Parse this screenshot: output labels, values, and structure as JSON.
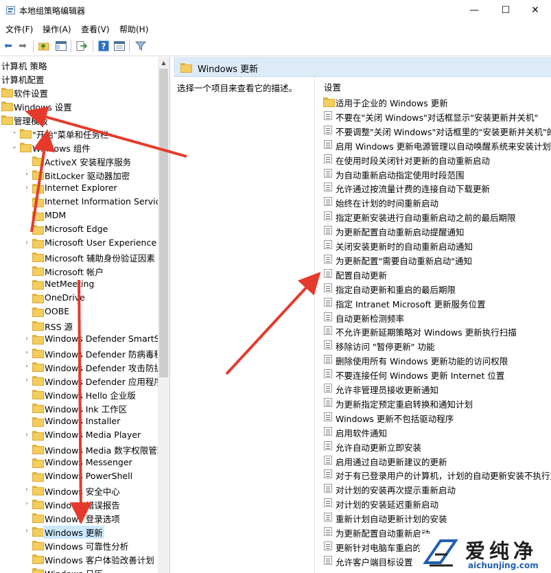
{
  "window": {
    "title": "本地组策略编辑器",
    "min_glyph": "—",
    "max_glyph": "☐",
    "close_glyph": "✕"
  },
  "menu": [
    "文件(F)",
    "操作(A)",
    "查看(V)",
    "帮助(H)"
  ],
  "tree": {
    "items": [
      {
        "label": "计算机 策略",
        "level": 0,
        "expander": ""
      },
      {
        "label": "计算机配置",
        "level": 0,
        "expander": ""
      },
      {
        "label": "软件设置",
        "level": 0,
        "expander": "",
        "folder": true
      },
      {
        "label": "Windows 设置",
        "level": 0,
        "expander": "",
        "folder": true
      },
      {
        "label": "管理模板",
        "level": 0,
        "expander": "",
        "folder": true
      },
      {
        "label": "\"开始\"菜单和任务栏",
        "level": 1,
        "expander": "›"
      },
      {
        "label": "Windows 组件",
        "level": 1,
        "expander": "⌄"
      },
      {
        "label": "ActiveX 安装程序服务",
        "level": 2,
        "expander": ""
      },
      {
        "label": "BitLocker 驱动器加密",
        "level": 2,
        "expander": "›"
      },
      {
        "label": "Internet Explorer",
        "level": 2,
        "expander": "›"
      },
      {
        "label": "Internet Information Services",
        "level": 2,
        "expander": ""
      },
      {
        "label": "MDM",
        "level": 2,
        "expander": ""
      },
      {
        "label": "Microsoft Edge",
        "level": 2,
        "expander": ""
      },
      {
        "label": "Microsoft User Experience Virt",
        "level": 2,
        "expander": "›"
      },
      {
        "label": "Microsoft 辅助身份验证因素",
        "level": 2,
        "expander": ""
      },
      {
        "label": "Microsoft 帐户",
        "level": 2,
        "expander": ""
      },
      {
        "label": "NetMeeting",
        "level": 2,
        "expander": ""
      },
      {
        "label": "OneDrive",
        "level": 2,
        "expander": ""
      },
      {
        "label": "OOBE",
        "level": 2,
        "expander": ""
      },
      {
        "label": "RSS 源",
        "level": 2,
        "expander": ""
      },
      {
        "label": "Windows Defender SmartScre",
        "level": 2,
        "expander": "›"
      },
      {
        "label": "Windows Defender 防病毒程序",
        "level": 2,
        "expander": "›"
      },
      {
        "label": "Windows Defender 攻击防护",
        "level": 2,
        "expander": "›"
      },
      {
        "label": "Windows Defender 应用程序防",
        "level": 2,
        "expander": "›"
      },
      {
        "label": "Windows Hello 企业版",
        "level": 2,
        "expander": ""
      },
      {
        "label": "Windows Ink 工作区",
        "level": 2,
        "expander": ""
      },
      {
        "label": "Windows Installer",
        "level": 2,
        "expander": ""
      },
      {
        "label": "Windows Media Player",
        "level": 2,
        "expander": "›"
      },
      {
        "label": "Windows Media 数字权限管理",
        "level": 2,
        "expander": ""
      },
      {
        "label": "Windows Messenger",
        "level": 2,
        "expander": ""
      },
      {
        "label": "Windows PowerShell",
        "level": 2,
        "expander": ""
      },
      {
        "label": "Windows 安全中心",
        "level": 2,
        "expander": "›"
      },
      {
        "label": "Windows 错误报告",
        "level": 2,
        "expander": "›"
      },
      {
        "label": "Windows 登录选项",
        "level": 2,
        "expander": ""
      },
      {
        "label": "Windows 更新",
        "level": 2,
        "expander": "›",
        "selected": true
      },
      {
        "label": "Windows 可靠性分析",
        "level": 2,
        "expander": ""
      },
      {
        "label": "Windows 客户体验改善计划",
        "level": 2,
        "expander": ""
      },
      {
        "label": "Windows 日历",
        "level": 2,
        "expander": ""
      }
    ]
  },
  "right": {
    "header": "Windows 更新",
    "description": "选择一个项目来查看它的描述。",
    "column": "设置",
    "items": [
      {
        "label": "适用于企业的 Windows 更新",
        "icon": "folder"
      },
      {
        "label": "不要在\"关闭 Windows\"对话框显示\"安装更新并关机\"",
        "icon": "policy"
      },
      {
        "label": "不要调整\"关闭 Windows\"对话框里的\"安装更新并关机\"的默",
        "icon": "policy"
      },
      {
        "label": "启用 Windows 更新电源管理以自动唤醒系统来安装计划的...",
        "icon": "policy"
      },
      {
        "label": "在使用时段关闭针对更新的自动重新启动",
        "icon": "policy"
      },
      {
        "label": "为自动重新启动指定使用时段范围",
        "icon": "policy"
      },
      {
        "label": "允许通过按流量计费的连接自动下载更新",
        "icon": "policy"
      },
      {
        "label": "始终在计划的时间重新启动",
        "icon": "policy"
      },
      {
        "label": "指定更新安装进行自动重新启动之前的最后期限",
        "icon": "policy"
      },
      {
        "label": "为更新配置自动重新启动提醒通知",
        "icon": "policy"
      },
      {
        "label": "关闭安装更新时的自动重新启动通知",
        "icon": "policy"
      },
      {
        "label": "为更新配置\"需要自动重新启动\"通知",
        "icon": "policy"
      },
      {
        "label": "配置自动更新",
        "icon": "policy"
      },
      {
        "label": "指定自动更新和重启的最后期限",
        "icon": "policy"
      },
      {
        "label": "指定 Intranet Microsoft 更新服务位置",
        "icon": "policy"
      },
      {
        "label": "自动更新检测频率",
        "icon": "policy"
      },
      {
        "label": "不允许更新延期策略对 Windows 更新执行扫描",
        "icon": "policy"
      },
      {
        "label": "移除访问 \"暂停更新\" 功能",
        "icon": "policy"
      },
      {
        "label": "删除使用所有 Windows 更新功能的访问权限",
        "icon": "policy"
      },
      {
        "label": "不要连接任何 Windows 更新 Internet 位置",
        "icon": "policy"
      },
      {
        "label": "允许非管理员接收更新通知",
        "icon": "policy"
      },
      {
        "label": "为更新指定预定重启转换和通知计划",
        "icon": "policy"
      },
      {
        "label": "Windows 更新不包括驱动程序",
        "icon": "policy"
      },
      {
        "label": "启用软件通知",
        "icon": "policy"
      },
      {
        "label": "允许自动更新立即安装",
        "icon": "policy"
      },
      {
        "label": "启用通过自动更新建议的更新",
        "icon": "policy"
      },
      {
        "label": "对于有已登录用户的计算机，计划的自动更新安装不执行重...",
        "icon": "policy"
      },
      {
        "label": "对计划的安装再次提示重新启动",
        "icon": "policy"
      },
      {
        "label": "对计划的安装延迟重新启动",
        "icon": "policy"
      },
      {
        "label": "重新计划自动更新计划的安装",
        "icon": "policy"
      },
      {
        "label": "为更新配置自动重新启动",
        "icon": "policy"
      },
      {
        "label": "更新针对电脑车重启的",
        "icon": "policy"
      },
      {
        "label": "允许客户端目标设置",
        "icon": "policy"
      }
    ]
  },
  "watermark": {
    "cn": "爱纯净",
    "en": "aichunjing.com"
  },
  "colors": {
    "arrow": "#e53a2b",
    "header_bg": "#ddeaf7",
    "selection": "#cce8ff"
  }
}
